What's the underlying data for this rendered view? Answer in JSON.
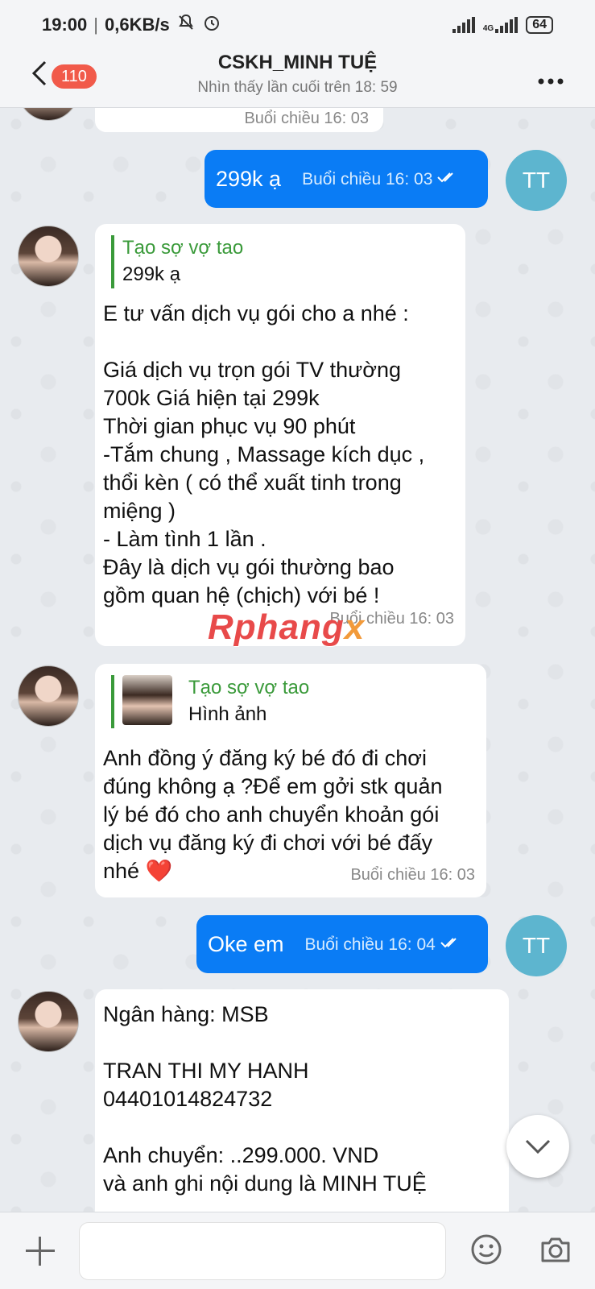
{
  "status_bar": {
    "time": "19:00",
    "net_speed": "0,6KB/s",
    "network": "4G",
    "battery": "64"
  },
  "header": {
    "unread_count": "110",
    "title": "CSKH_MINH TUỆ",
    "subtitle": "Nhìn thấy lần cuối trên 18: 59"
  },
  "messages": [
    {
      "sender": "them",
      "timestamp": "Buổi chiều  16: 03"
    },
    {
      "sender": "me",
      "avatar": "TT",
      "text": "299k ạ",
      "timestamp": "Buổi chiều  16: 03"
    },
    {
      "sender": "them",
      "quote_name": "Tạo sợ vợ tao",
      "quote_text": "299k ạ",
      "text": "E tư vấn dịch vụ gói cho a nhé :\n\nGiá dịch vụ trọn gói TV thường\n700k Giá hiện tại 299k\nThời gian phục vụ 90 phút\n-Tắm chung , Massage kích dục ,\nthổi kèn ( có thể xuất tinh trong\nmiệng )\n- Làm tình 1  lần .\nĐây là dịch vụ gói thường bao\ngồm quan hệ (chịch) với bé !",
      "timestamp": "Buổi chiều  16: 03"
    },
    {
      "sender": "them",
      "quote_name": "Tạo sợ vợ tao",
      "quote_text": "Hình ảnh",
      "text": "Anh  đồng ý đăng ký bé đó đi chơi\nđúng không ạ ?Để em gởi stk quản\nlý bé đó cho anh chuyển khoản gói\ndịch vụ đăng ký đi chơi với bé đấy\nnhé ❤️",
      "timestamp": "Buổi chiều  16: 03"
    },
    {
      "sender": "me",
      "avatar": "TT",
      "text": "Oke em",
      "timestamp": "Buổi chiều  16: 04"
    },
    {
      "sender": "them",
      "text": "Ngân hàng:  MSB\n\nTRAN THI MY HANH\n04401014824732\n\nAnh chuyển: ..299.000. VND\n và anh ghi nội dung là MINH TUỆ"
    }
  ],
  "watermark": {
    "main": "Rphang",
    "x": "x"
  },
  "input": {
    "placeholder": ""
  },
  "colors": {
    "my_bubble": "#0a7cf5",
    "quote_accent": "#3a9a3a",
    "tt_avatar": "#5db5cf",
    "badge": "#f15a4a"
  }
}
